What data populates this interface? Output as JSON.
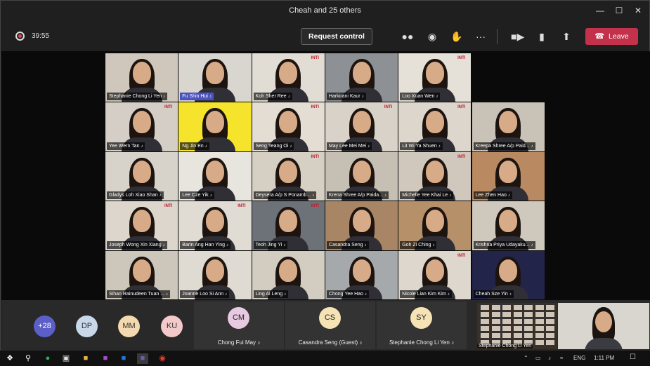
{
  "window": {
    "title": "Cheah and 25 others"
  },
  "toolbar": {
    "timer": "39:55",
    "request_control": "Request control",
    "leave": "Leave",
    "icons": [
      "participants-icon",
      "chat-icon",
      "reactions-icon",
      "more-icon",
      "camera-icon",
      "mic-icon",
      "share-icon"
    ]
  },
  "grid": [
    [
      {
        "name": "Stephanie Chong Li Yen",
        "bg": "#cfc7bb",
        "logo": ""
      },
      {
        "name": "Fu Shin Hui",
        "bg": "#d9d5cf",
        "logo": "",
        "highlighted": true
      },
      {
        "name": "Koh Sher Ree",
        "bg": "#e2ddd4",
        "logo": "INTI"
      },
      {
        "name": "Harkirani Kaur",
        "bg": "#8d9196",
        "logo": ""
      },
      {
        "name": "Loo Xuan Wen",
        "bg": "#e5e0d8",
        "logo": "INTI"
      }
    ],
    [
      {
        "name": "Yee Wern Tan",
        "bg": "#d4cec6",
        "logo": "INTI"
      },
      {
        "name": "Ng Jin En",
        "bg": "#f5e32c",
        "logo": ""
      },
      {
        "name": "Seng Yeang Oi",
        "bg": "#e3ddd3",
        "logo": "INTI"
      },
      {
        "name": "May Lee Mei Mei",
        "bg": "#d9d2c8",
        "logo": "INTI"
      },
      {
        "name": "Lit Wi Ya Shuen",
        "bg": "#ddd6cc",
        "logo": "INTI"
      },
      {
        "name": "Kreepa Shree A/p Paid...",
        "bg": "#c9c2b7",
        "logo": ""
      }
    ],
    [
      {
        "name": "Gladys Loh Xiao Shan",
        "bg": "#d8d3ca",
        "logo": ""
      },
      {
        "name": "Lee Cze Yik",
        "bg": "#e8e5df",
        "logo": ""
      },
      {
        "name": "Deysera A/p S Ponamb...",
        "bg": "#d6cfc4",
        "logo": "INTI"
      },
      {
        "name": "Krena Shree A/p Paida...",
        "bg": "#c5bfb4",
        "logo": ""
      },
      {
        "name": "Michelle Yee Khai Le",
        "bg": "#d0c8bc",
        "logo": "INTI"
      },
      {
        "name": "Lee Zhen Hao",
        "bg": "#b98a62",
        "logo": ""
      }
    ],
    [
      {
        "name": "Joseph Wong Xin Xiang",
        "bg": "#dcd6cc",
        "logo": "INTI"
      },
      {
        "name": "Barin Ang Han Ying",
        "bg": "#e1dcd3",
        "logo": "INTI"
      },
      {
        "name": "Teoh Jing Yi",
        "bg": "#6d7278",
        "logo": "INTI"
      },
      {
        "name": "Casandra Seng",
        "bg": "#a88665",
        "logo": ""
      },
      {
        "name": "Goh Zi Ching",
        "bg": "#b69068",
        "logo": ""
      },
      {
        "name": "Krishna Priya Udayaku...",
        "bg": "#cfc8bd",
        "logo": ""
      }
    ],
    [
      {
        "name": "Sihan Rainudeen Tuan ...",
        "bg": "#cdc6bb",
        "logo": ""
      },
      {
        "name": "Joanne Loo Si Ann",
        "bg": "#dfdad2",
        "logo": ""
      },
      {
        "name": "Ling Ai Leng",
        "bg": "#d3ccc1",
        "logo": ""
      },
      {
        "name": "Chong Yee Hao",
        "bg": "#a6a9ac",
        "logo": ""
      },
      {
        "name": "Nicole Lian Kim Kim",
        "bg": "#ddd7ce",
        "logo": "INTI"
      },
      {
        "name": "Cheah Sze Yin",
        "bg": "#23244a",
        "logo": ""
      }
    ]
  ],
  "roster": {
    "avatars": [
      {
        "initials": "+28",
        "color": "#5b5fc7",
        "text_color": "#ffffff"
      },
      {
        "initials": "DP",
        "color": "#c8d8e8",
        "text_color": "#333333"
      },
      {
        "initials": "MM",
        "color": "#f3d9b0",
        "text_color": "#333333"
      },
      {
        "initials": "KU",
        "color": "#f3c9c9",
        "text_color": "#333333"
      }
    ],
    "cards": [
      {
        "initials": "CM",
        "name": "Chong Fui May",
        "color": "#e7c9e2"
      },
      {
        "initials": "CS",
        "name": "Casandra Seng (Guest)",
        "color": "#f5e3b5"
      },
      {
        "initials": "SY",
        "name": "Stephanie Chong Li Yen",
        "color": "#f5e3b5"
      }
    ],
    "screen_share_name": "Stephanie Chong Li Yen"
  },
  "taskbar": {
    "lang": "ENG",
    "time": "1:11 PM"
  }
}
